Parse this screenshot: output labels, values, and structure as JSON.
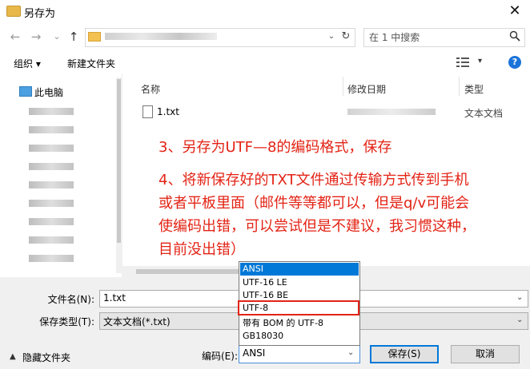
{
  "window": {
    "title": "另存为",
    "close_glyph": "✕"
  },
  "nav": {
    "back_glyph": "←",
    "forward_glyph": "→",
    "recent_glyph": "⌄",
    "up_glyph": "↑",
    "refresh_glyph": "↻",
    "address_chev": "⌄"
  },
  "search": {
    "placeholder": "在 1 中搜索"
  },
  "toolbar": {
    "organize": "组织 ▾",
    "new_folder": "新建文件夹",
    "view_chev": "▾",
    "help": "?"
  },
  "sidebar": {
    "this_pc": "此电脑"
  },
  "columns": {
    "name": "名称",
    "date": "修改日期",
    "type": "类型"
  },
  "files": [
    {
      "name": "1.txt",
      "type": "文本文档"
    }
  ],
  "annotation": {
    "line1": "3、另存为UTF—8的编码格式，保存",
    "line2": "4、将新保存好的TXT文件通过传输方式传到手机",
    "line3": "或者平板里面（邮件等等都可以，但是q/v可能会",
    "line4": "使编码出错，可以尝试但是不建议，我习惯这种，",
    "line5": "目前没出错）"
  },
  "form": {
    "filename_label": "文件名(N):",
    "filename_value": "1.txt",
    "filetype_label": "保存类型(T):",
    "filetype_value": "文本文档(*.txt)",
    "hide_folders": "隐藏文件夹",
    "hide_glyph": "▲",
    "encoding_label": "编码(E):",
    "encoding_value": "ANSI",
    "save": "保存(S)",
    "cancel": "取消",
    "dd_chev": "⌄"
  },
  "encoding_options": [
    "ANSI",
    "UTF-16 LE",
    "UTF-16 BE",
    "UTF-8",
    "带有 BOM 的 UTF-8",
    "GB18030"
  ],
  "colors": {
    "annotation": "#e32315",
    "selection": "#0078d7"
  }
}
